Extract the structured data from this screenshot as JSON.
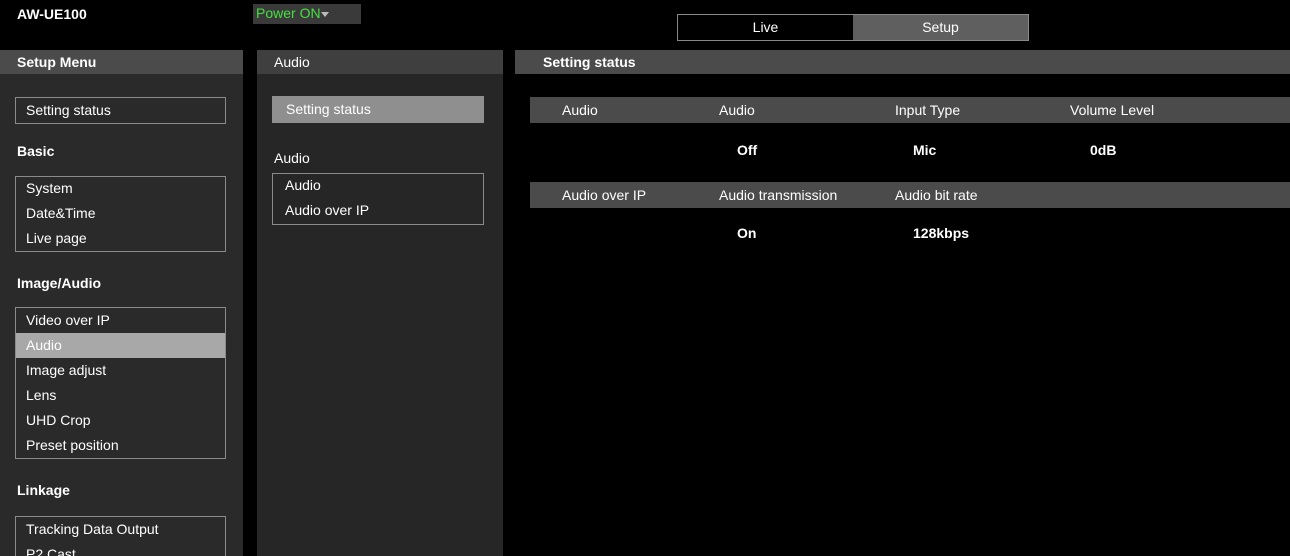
{
  "header": {
    "model": "AW-UE100",
    "power": "Power ON",
    "tabs": [
      {
        "label": "Live",
        "active": false
      },
      {
        "label": "Setup",
        "active": true
      }
    ]
  },
  "titles": {
    "left": "Setup Menu",
    "middle": "Audio",
    "right": "Setting status"
  },
  "sidebar": {
    "setting_status": "Setting status",
    "groups": {
      "basic": "Basic",
      "image_audio": "Image/Audio",
      "linkage": "Linkage"
    },
    "basic_items": [
      "System",
      "Date&Time",
      "Live page"
    ],
    "image_items": [
      "Video over IP",
      "Audio",
      "Image adjust",
      "Lens",
      "UHD Crop",
      "Preset position"
    ],
    "linkage_items": [
      "Tracking Data Output",
      "P2 Cast"
    ],
    "selected": "Audio"
  },
  "middle": {
    "setting_status": "Setting status",
    "group": "Audio",
    "items": [
      "Audio",
      "Audio over IP"
    ]
  },
  "status": {
    "audio": {
      "section": "Audio",
      "headers": [
        "Audio",
        "Input Type",
        "Volume Level"
      ],
      "values": [
        "Off",
        "Mic",
        "0dB"
      ]
    },
    "audio_ip": {
      "section": "Audio over IP",
      "headers": [
        "Audio transmission",
        "Audio bit rate"
      ],
      "values": [
        "On",
        "128kbps"
      ]
    }
  },
  "colors": {
    "power_on": "#44e040",
    "selected_item": "#a8a8a8",
    "header_strip": "#4b4b4b"
  }
}
